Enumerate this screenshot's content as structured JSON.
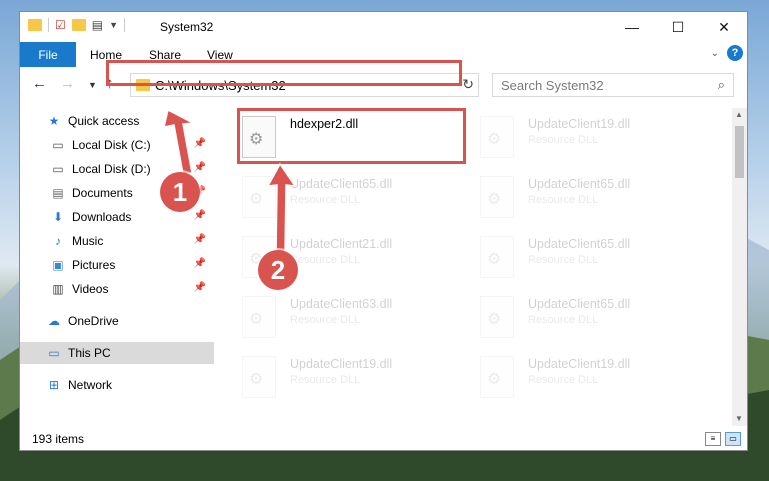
{
  "window": {
    "title": "System32",
    "minimize_glyph": "—",
    "maximize_glyph": "☐",
    "close_glyph": "✕"
  },
  "ribbon": {
    "tabs": [
      {
        "label": "File"
      },
      {
        "label": "Home"
      },
      {
        "label": "Share"
      },
      {
        "label": "View"
      }
    ]
  },
  "address_bar": {
    "path": "C:\\Windows\\System32"
  },
  "search": {
    "placeholder": "Search System32"
  },
  "sidebar": {
    "items": [
      {
        "label": "Quick access",
        "icon": "star-icon"
      },
      {
        "label": "Local Disk (C:)",
        "icon": "drive-icon",
        "pinned": true
      },
      {
        "label": "Local Disk (D:)",
        "icon": "drive-icon",
        "pinned": true
      },
      {
        "label": "Documents",
        "icon": "documents-icon",
        "pinned": true
      },
      {
        "label": "Downloads",
        "icon": "download-icon",
        "pinned": true
      },
      {
        "label": "Music",
        "icon": "music-icon",
        "pinned": true
      },
      {
        "label": "Pictures",
        "icon": "pictures-icon",
        "pinned": true
      },
      {
        "label": "Videos",
        "icon": "videos-icon",
        "pinned": true
      },
      {
        "label": "OneDrive",
        "icon": "cloud-icon"
      },
      {
        "label": "This PC",
        "icon": "computer-icon",
        "selected": true
      },
      {
        "label": "Network",
        "icon": "network-icon"
      }
    ]
  },
  "files": {
    "target": {
      "name": "hdexper2.dll"
    },
    "faded": [
      {
        "name": "UpdateClient19.dll",
        "type": "Resource DLL"
      },
      {
        "name": "UpdateClient65.dll",
        "type": "Resource DLL"
      },
      {
        "name": "UpdateClient65.dll",
        "type": "Resource DLL"
      },
      {
        "name": "UpdateClient21.dll",
        "type": "Resource DLL"
      },
      {
        "name": "UpdateClient65.dll",
        "type": "Resource DLL"
      },
      {
        "name": "UpdateClient63.dll",
        "type": "Resource DLL"
      },
      {
        "name": "UpdateClient65.dll",
        "type": "Resource DLL"
      },
      {
        "name": "UpdateClient19.dll",
        "type": "Resource DLL"
      },
      {
        "name": "UpdateClient19.dll",
        "type": "Resource DLL"
      }
    ]
  },
  "status": {
    "item_count": "193 items"
  },
  "callouts": {
    "one": "1",
    "two": "2"
  },
  "colors": {
    "accent": "#1979ca",
    "callout": "#d9534f"
  }
}
